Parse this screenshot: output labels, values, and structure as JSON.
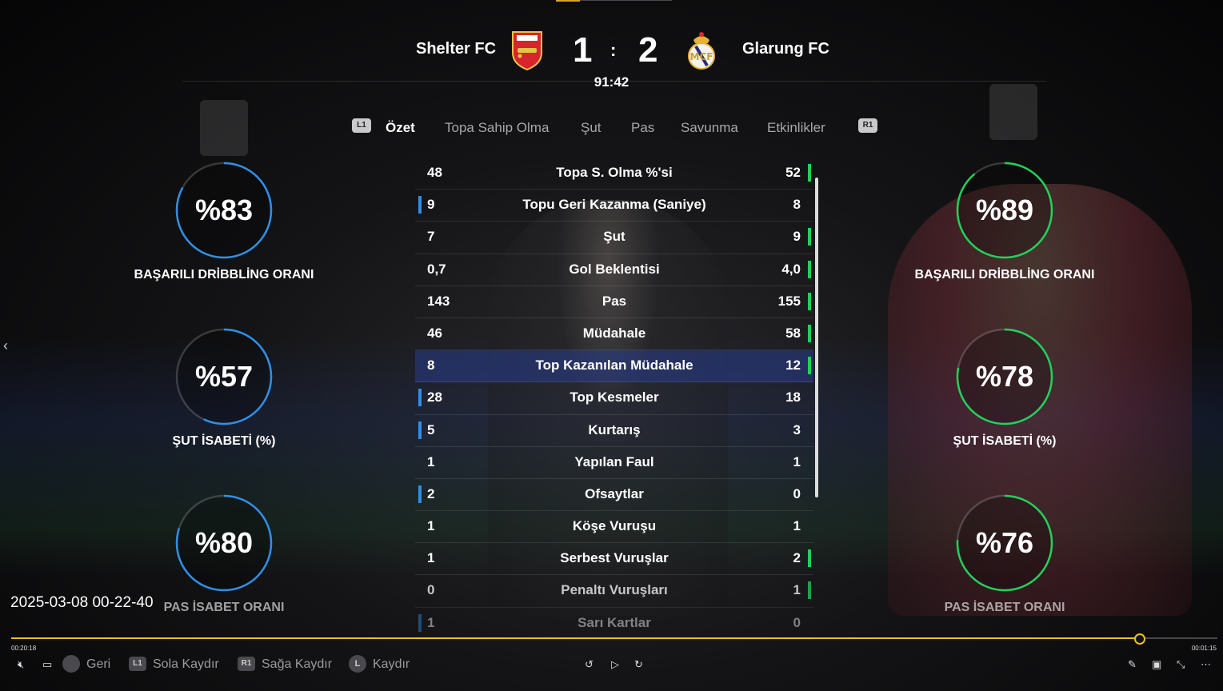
{
  "header": {
    "home_team": "Shelter FC",
    "away_team": "Glarung FC",
    "home_score": "1",
    "away_score": "2",
    "separator": ":",
    "clock": "91:42"
  },
  "tabs": {
    "left_bumper": "L1",
    "right_bumper": "R1",
    "items": [
      "Özet",
      "Topa Sahip Olma",
      "Şut",
      "Pas",
      "Savunma",
      "Etkinlikler"
    ]
  },
  "left_gauges": [
    {
      "value": "%83",
      "label": "BAŞARILI DRİBBLİNG ORANI",
      "percent": 83
    },
    {
      "value": "%57",
      "label": "ŞUT İSABETİ (%)",
      "percent": 57
    },
    {
      "value": "%80",
      "label": "PAS İSABET ORANI",
      "percent": 80
    }
  ],
  "right_gauges": [
    {
      "value": "%89",
      "label": "BAŞARILI DRİBBLİNG ORANI",
      "percent": 89
    },
    {
      "value": "%78",
      "label": "ŞUT İSABETİ (%)",
      "percent": 78
    },
    {
      "value": "%76",
      "label": "PAS İSABET ORANI",
      "percent": 76
    }
  ],
  "stats": [
    {
      "home": "48",
      "label": "Topa S. Olma %'si",
      "away": "52",
      "leader": "away"
    },
    {
      "home": "9",
      "label": "Topu Geri Kazanma (Saniye)",
      "away": "8",
      "leader": "home"
    },
    {
      "home": "7",
      "label": "Şut",
      "away": "9",
      "leader": "away"
    },
    {
      "home": "0,7",
      "label": "Gol Beklentisi",
      "away": "4,0",
      "leader": "away"
    },
    {
      "home": "143",
      "label": "Pas",
      "away": "155",
      "leader": "away"
    },
    {
      "home": "46",
      "label": "Müdahale",
      "away": "58",
      "leader": "away"
    },
    {
      "home": "8",
      "label": "Top Kazanılan Müdahale",
      "away": "12",
      "leader": "away",
      "selected": true
    },
    {
      "home": "28",
      "label": "Top Kesmeler",
      "away": "18",
      "leader": "home"
    },
    {
      "home": "5",
      "label": "Kurtarış",
      "away": "3",
      "leader": "home"
    },
    {
      "home": "1",
      "label": "Yapılan Faul",
      "away": "1",
      "leader": "none"
    },
    {
      "home": "2",
      "label": "Ofsaytlar",
      "away": "0",
      "leader": "home"
    },
    {
      "home": "1",
      "label": "Köşe Vuruşu",
      "away": "1",
      "leader": "none"
    },
    {
      "home": "1",
      "label": "Serbest Vuruşlar",
      "away": "2",
      "leader": "away"
    },
    {
      "home": "0",
      "label": "Penaltı Vuruşları",
      "away": "1",
      "leader": "away"
    },
    {
      "home": "1",
      "label": "Sarı Kartlar",
      "away": "0",
      "leader": "home"
    }
  ],
  "overlay": {
    "timestamp": "2025-03-08 00-22-40"
  },
  "player": {
    "elapsed": "00:20:18",
    "remaining": "00:01:15",
    "progress_fraction": 0.935
  },
  "controls": {
    "back_label": "Geri",
    "left_label": "Sola Kaydır",
    "right_label": "Sağa Kaydır",
    "scroll_label": "Kaydır",
    "l1_badge": "L1",
    "r1_badge": "R1",
    "l_badge": "L"
  },
  "colors": {
    "home_accent": "#2f8fe8",
    "away_accent": "#22d05a",
    "progress": "#f0c020"
  }
}
